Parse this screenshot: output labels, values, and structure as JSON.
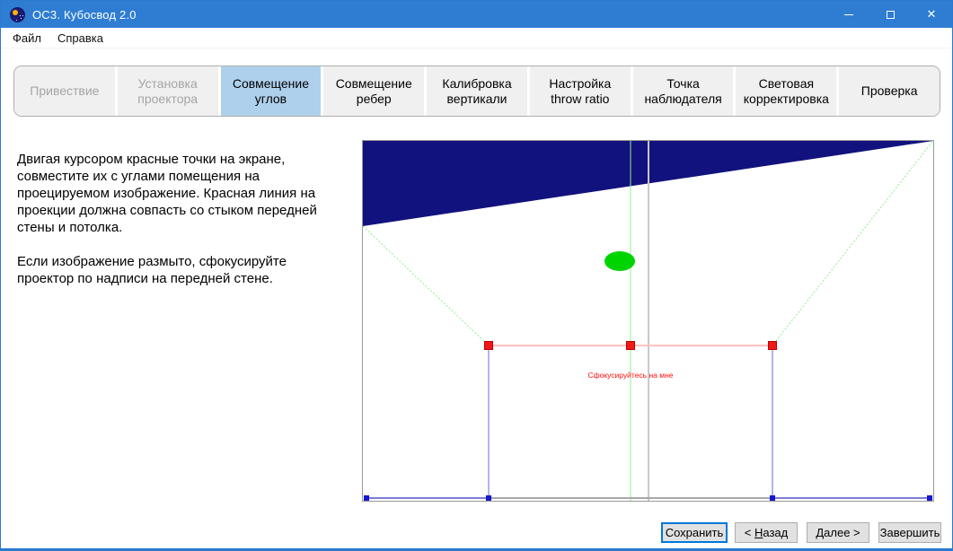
{
  "window": {
    "title": "ОС3. Кубосвод 2.0"
  },
  "menu": {
    "items": [
      {
        "label": "Файл"
      },
      {
        "label": "Справка"
      }
    ]
  },
  "tabs": [
    {
      "label": "Привествие",
      "state": "disabled"
    },
    {
      "label": "Установка проектора",
      "state": "disabled"
    },
    {
      "label": "Совмещение углов",
      "state": "active"
    },
    {
      "label": "Совмещение ребер",
      "state": "normal"
    },
    {
      "label": "Калибровка вертикали",
      "state": "normal"
    },
    {
      "label": "Настройка throw ratio",
      "state": "normal"
    },
    {
      "label": "Точка наблюдателя",
      "state": "normal"
    },
    {
      "label": "Световая корректировка",
      "state": "normal"
    },
    {
      "label": "Проверка",
      "state": "normal"
    }
  ],
  "instructions": {
    "paragraph1": "Двигая курсором красные точки на экране, совместите их с углами помещения на проецируемом изображение. Красная линия на проекции должна совпасть со стыком передней стены и потолка.",
    "paragraph2": "Если изображение размыто, сфокусируйте проектор по надписи на передней стене."
  },
  "canvas": {
    "focus_label": "Сфокусируйтесь на мне",
    "colors": {
      "ceiling_navy": "#12127e",
      "grid_green": "#90ee90",
      "marker_green": "#00d400",
      "handle_red": "#f01818",
      "line_red": "#ffc0c0",
      "edge_blue": "#9a9ae6",
      "floor_blue": "#7d7dd8",
      "node_blue": "#1818cc",
      "guide_gray": "#c8c8c8",
      "floor_gray": "#a8a8a8",
      "label_red": "#ff1010"
    }
  },
  "footer": {
    "save": {
      "label": "Сохранить"
    },
    "back": {
      "pre": "< ",
      "key": "Н",
      "rest": "азад"
    },
    "next": {
      "pre": "",
      "key": "Д",
      "rest": "алее >"
    },
    "finish": {
      "label": "Завершить"
    }
  }
}
